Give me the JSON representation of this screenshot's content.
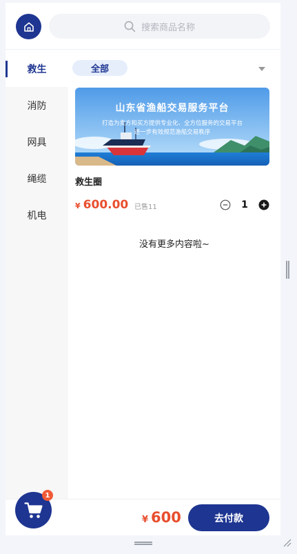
{
  "search": {
    "placeholder": "搜索商品名称"
  },
  "sidebar": {
    "items": [
      {
        "label": "救生",
        "active": true
      },
      {
        "label": "消防"
      },
      {
        "label": "网具"
      },
      {
        "label": "绳缆"
      },
      {
        "label": "机电"
      }
    ]
  },
  "filter": {
    "chip_label": "全部"
  },
  "banner": {
    "title": "山东省渔船交易服务平台",
    "subtitle_line1": "打造为卖方和买方提供专业化、全方位服务的交易平台",
    "subtitle_line2": "进一步有效规范渔船交易秩序"
  },
  "product": {
    "name": "救生圈",
    "currency": "¥",
    "price": "600.00",
    "sold": "已售11",
    "quantity": "1"
  },
  "list": {
    "end_text": "没有更多内容啦~"
  },
  "footer": {
    "currency": "¥",
    "total": "600",
    "pay_label": "去付款",
    "cart_badge": "1"
  },
  "colors": {
    "brand": "#1e3591",
    "price": "#e84e2e",
    "badge": "#f05a37"
  }
}
